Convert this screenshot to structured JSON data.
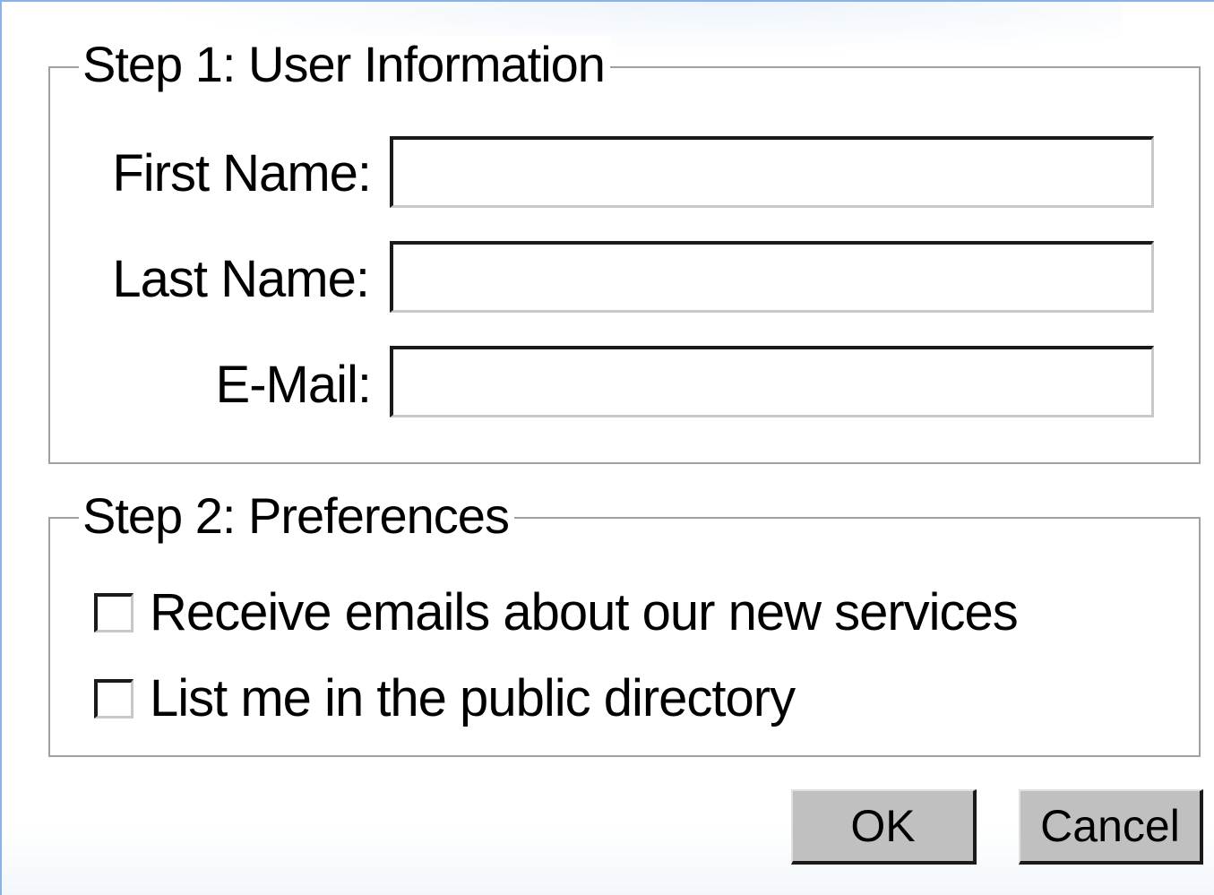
{
  "step1": {
    "legend": "Step 1: User Information",
    "first_name_label": "First Name:",
    "first_name_value": "",
    "last_name_label": "Last Name:",
    "last_name_value": "",
    "email_label": "E-Mail:",
    "email_value": ""
  },
  "step2": {
    "legend": "Step 2: Preferences",
    "options": [
      {
        "label": "Receive emails about our new services",
        "checked": false
      },
      {
        "label": "List me in the public directory",
        "checked": false
      }
    ]
  },
  "buttons": {
    "ok_label": "OK",
    "cancel_label": "Cancel"
  }
}
